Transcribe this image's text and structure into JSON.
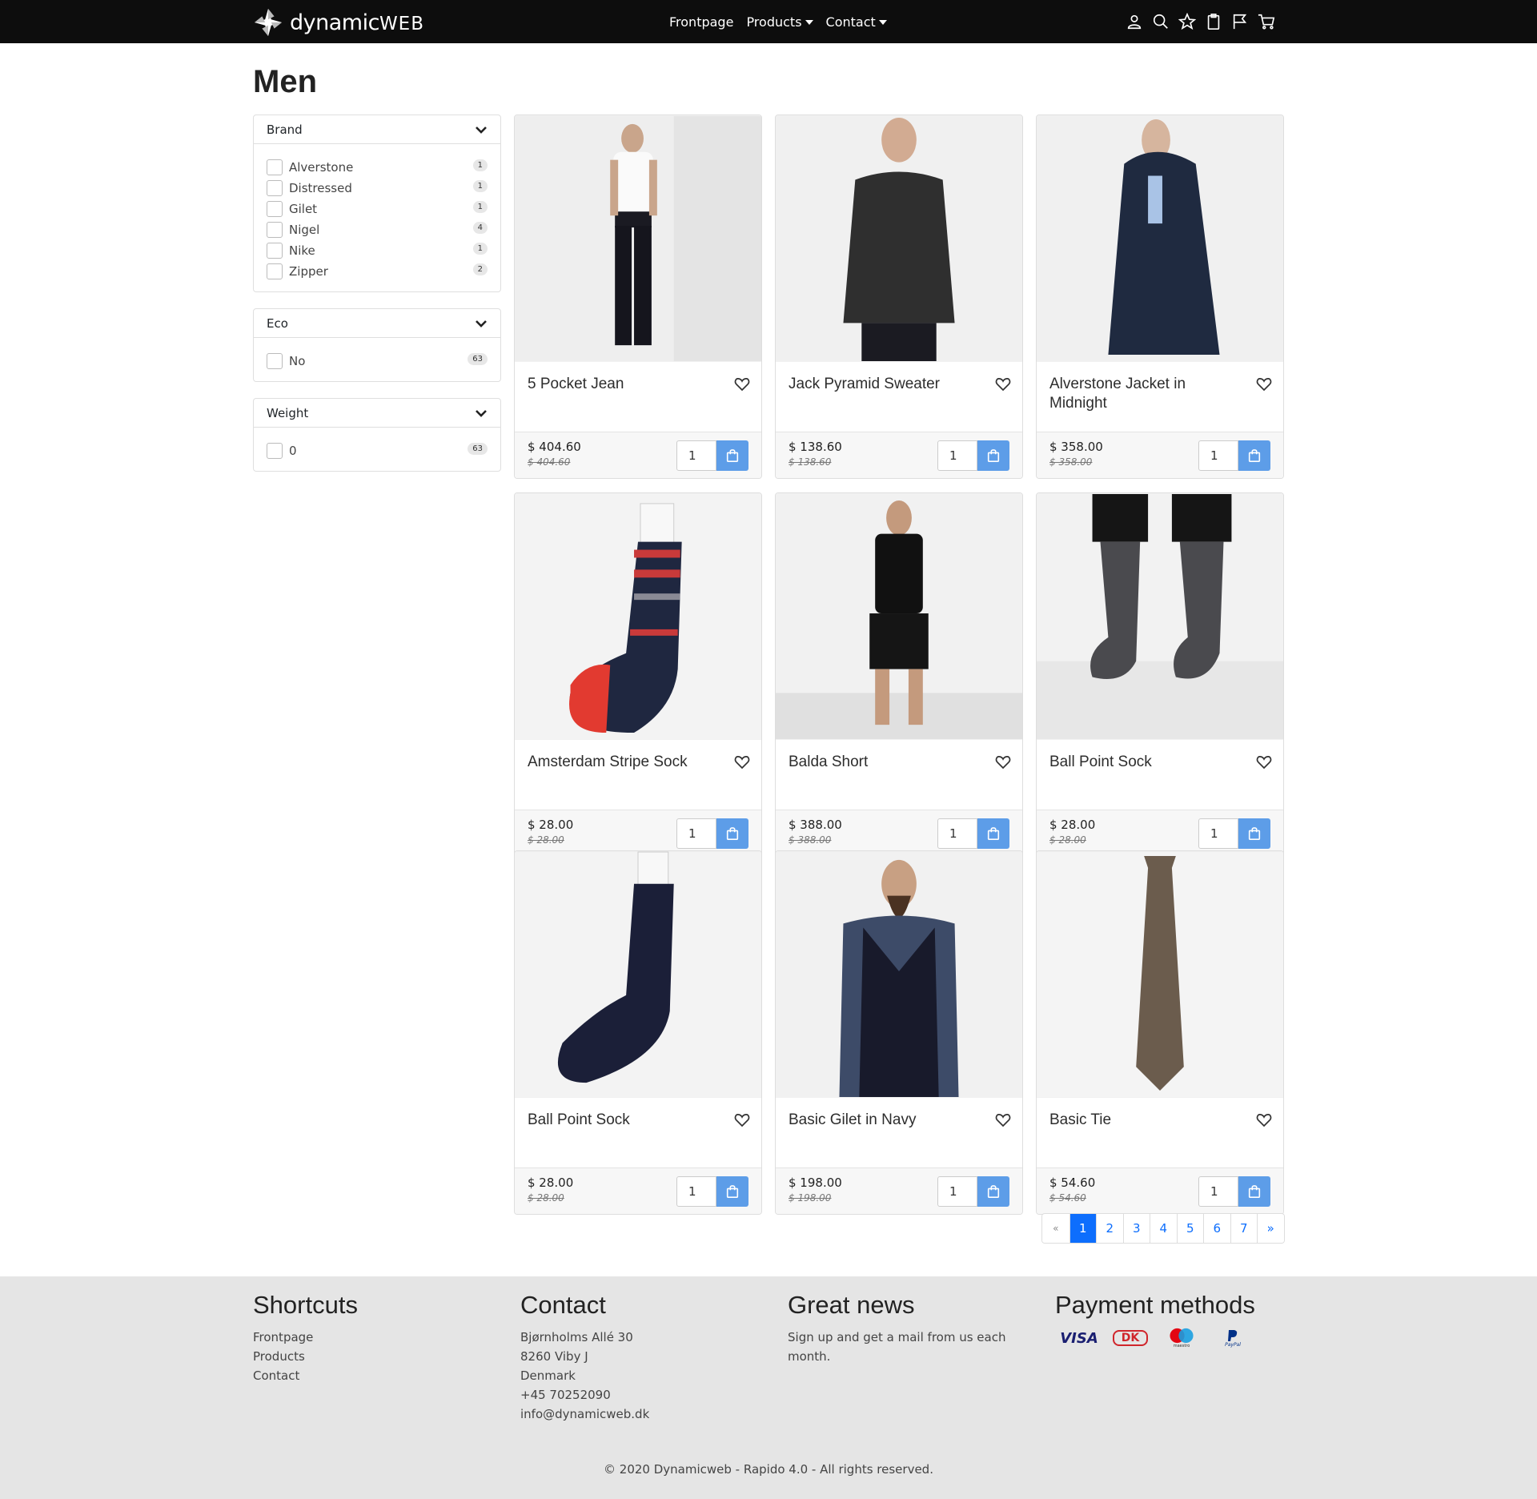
{
  "brand": {
    "name_main": "dynamic",
    "name_suffix": "WEB"
  },
  "nav": {
    "frontpage": "Frontpage",
    "products": "Products",
    "contact": "Contact"
  },
  "header_icons": [
    "user-icon",
    "search-icon",
    "star-icon",
    "clipboard-icon",
    "flag-icon",
    "cart-icon"
  ],
  "page_title": "Men",
  "filters": {
    "brand": {
      "title": "Brand",
      "options": [
        {
          "label": "Alverstone",
          "count": "1"
        },
        {
          "label": "Distressed",
          "count": "1"
        },
        {
          "label": "Gilet",
          "count": "1"
        },
        {
          "label": "Nigel",
          "count": "4"
        },
        {
          "label": "Nike",
          "count": "1"
        },
        {
          "label": "Zipper",
          "count": "2"
        }
      ]
    },
    "eco": {
      "title": "Eco",
      "options": [
        {
          "label": "No",
          "count": "63"
        }
      ]
    },
    "weight": {
      "title": "Weight",
      "options": [
        {
          "label": "0",
          "count": "63"
        }
      ]
    }
  },
  "products": [
    {
      "name": "5 Pocket Jean",
      "price": "$ 404.60",
      "old_price": "$ 404.60",
      "qty": "1"
    },
    {
      "name": "Jack Pyramid Sweater",
      "price": "$ 138.60",
      "old_price": "$ 138.60",
      "qty": "1"
    },
    {
      "name": "Alverstone Jacket in Midnight",
      "price": "$ 358.00",
      "old_price": "$ 358.00",
      "qty": "1"
    },
    {
      "name": "Amsterdam Stripe Sock",
      "price": "$ 28.00",
      "old_price": "$ 28.00",
      "qty": "1"
    },
    {
      "name": "Balda Short",
      "price": "$ 388.00",
      "old_price": "$ 388.00",
      "qty": "1"
    },
    {
      "name": "Ball Point Sock",
      "price": "$ 28.00",
      "old_price": "$ 28.00",
      "qty": "1"
    },
    {
      "name": "Ball Point Sock",
      "price": "$ 28.00",
      "old_price": "$ 28.00",
      "qty": "1"
    },
    {
      "name": "Basic Gilet in Navy",
      "price": "$ 198.00",
      "old_price": "$ 198.00",
      "qty": "1"
    },
    {
      "name": "Basic Tie",
      "price": "$ 54.60",
      "old_price": "$ 54.60",
      "qty": "1"
    }
  ],
  "pagination": {
    "prev": "«",
    "pages": [
      "1",
      "2",
      "3",
      "4",
      "5",
      "6",
      "7"
    ],
    "next": "»",
    "active": "1"
  },
  "footer": {
    "shortcuts": {
      "title": "Shortcuts",
      "links": [
        "Frontpage",
        "Products",
        "Contact"
      ]
    },
    "contact": {
      "title": "Contact",
      "lines": [
        "Bjørnholms Allé 30",
        "8260 Viby J",
        "Denmark",
        "+45 70252090",
        "info@dynamicweb.dk"
      ]
    },
    "news": {
      "title": "Great news",
      "text_1": "Sign up and get a mail from us each",
      "text_2": "month."
    },
    "payment": {
      "title": "Payment methods",
      "visa": "VISA",
      "dk": "DK",
      "maestro": "maestro",
      "paypal": "PayPal"
    },
    "copyright": "© 2020 Dynamicweb - Rapido 4.0 - All rights reserved."
  },
  "colors": {
    "accent": "#0d6efd",
    "cart_button": "#5d9de8",
    "topbar": "#0d0d0d",
    "footer_bg": "#e5e5e5"
  }
}
